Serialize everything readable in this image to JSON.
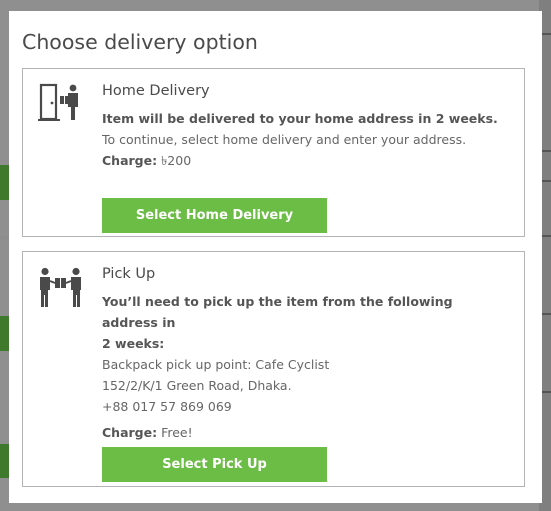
{
  "modal": {
    "title": "Choose delivery option"
  },
  "home_delivery": {
    "icon": "door-delivery-icon",
    "title": "Home Delivery",
    "description_bold": "Item will be delivered to your home address in 2 weeks.",
    "instruction": "To continue, select home delivery and enter your address.",
    "charge_label": "Charge:",
    "charge_value": " ৳200",
    "button_label": "Select Home Delivery"
  },
  "pick_up": {
    "icon": "handover-icon",
    "title": "Pick Up",
    "description_bold_1": "You’ll need to pick up the item from the following address in",
    "description_bold_2": "2 weeks:",
    "address_line_1": "Backpack pick up point: Cafe Cyclist",
    "address_line_2": "152/2/K/1 Green Road, Dhaka.",
    "phone": "+88 017 57 869 069",
    "charge_label": "Charge:",
    "charge_value": " Free!",
    "button_label": "Select Pick Up"
  },
  "colors": {
    "button": "#6cbd45",
    "border": "#b3b3b3",
    "overlay": "#8f8f8f"
  }
}
